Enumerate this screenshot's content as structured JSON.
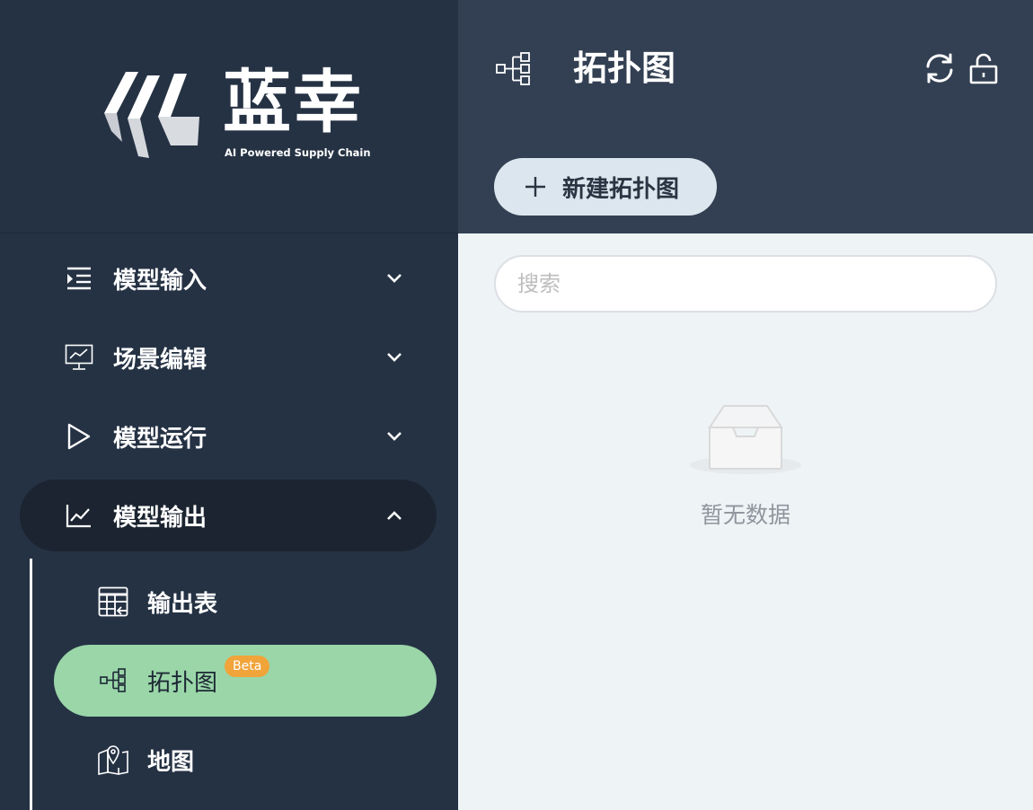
{
  "brand": {
    "name": "蓝幸",
    "tagline": "AI Powered Supply Chain"
  },
  "nav": {
    "groups": [
      {
        "label": "模型输入",
        "icon": "indent-list-icon",
        "expanded": false
      },
      {
        "label": "场景编辑",
        "icon": "monitor-chart-icon",
        "expanded": false
      },
      {
        "label": "模型运行",
        "icon": "play-icon",
        "expanded": false
      },
      {
        "label": "模型输出",
        "icon": "line-chart-icon",
        "expanded": true
      }
    ],
    "output_items": [
      {
        "label": "输出表",
        "icon": "table-export-icon"
      },
      {
        "label": "拓扑图",
        "icon": "topology-icon",
        "badge": "Beta",
        "selected": true
      },
      {
        "label": "地图",
        "icon": "map-pin-icon"
      }
    ]
  },
  "header": {
    "title": "拓扑图",
    "new_button_label": "新建拓扑图"
  },
  "search": {
    "placeholder": "搜索",
    "value": ""
  },
  "empty_state": {
    "text": "暂无数据"
  },
  "colors": {
    "sidebar_bg": "#253244",
    "header_bg": "#334053",
    "selected_item": "#9ad6a8",
    "beta_badge": "#f0a43a",
    "content_bg": "#eef3f6"
  }
}
